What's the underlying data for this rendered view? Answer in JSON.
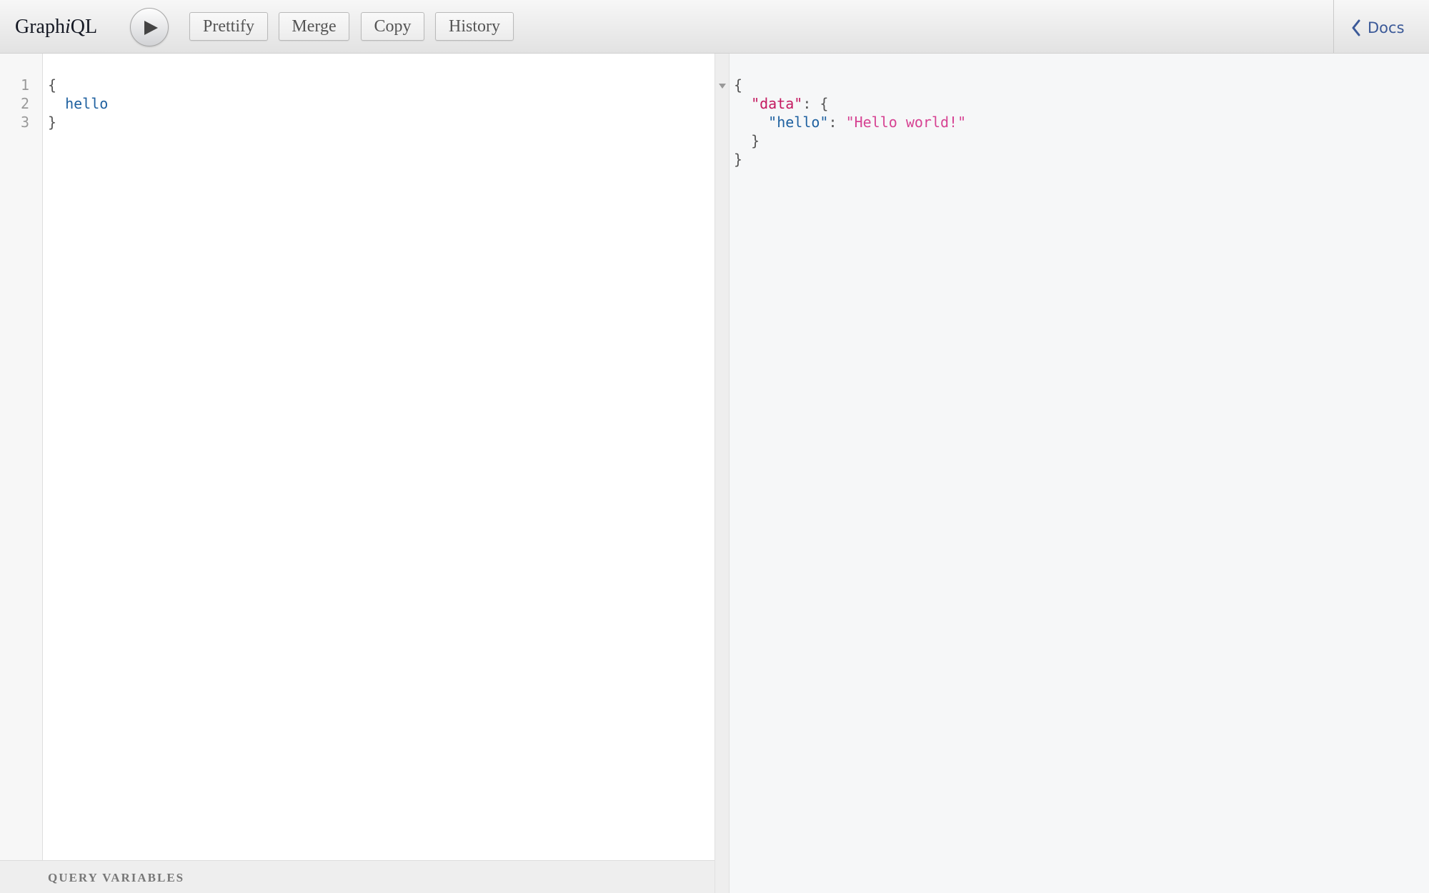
{
  "app": {
    "title_prefix": "Graph",
    "title_italic": "i",
    "title_suffix": "QL"
  },
  "toolbar": {
    "execute_icon": "play-icon",
    "buttons": [
      "Prettify",
      "Merge",
      "Copy",
      "History"
    ],
    "docs_label": "Docs",
    "docs_icon": "chevron-left-icon"
  },
  "query_editor": {
    "line_numbers": [
      "1",
      "2",
      "3"
    ],
    "lines": [
      "{",
      "  hello",
      "}"
    ]
  },
  "variables": {
    "title": "Query Variables"
  },
  "result": {
    "open_brace": "{",
    "data_key": "\"data\"",
    "data_sep": ": {",
    "hello_key": "\"hello\"",
    "hello_sep": ": ",
    "hello_value": "\"Hello world!\"",
    "inner_close": "  }",
    "outer_close": "}"
  },
  "colors": {
    "field": "#1f61a0",
    "result_key": "#c41a60",
    "string_value": "#d64292",
    "docs_link": "#3b5998"
  }
}
